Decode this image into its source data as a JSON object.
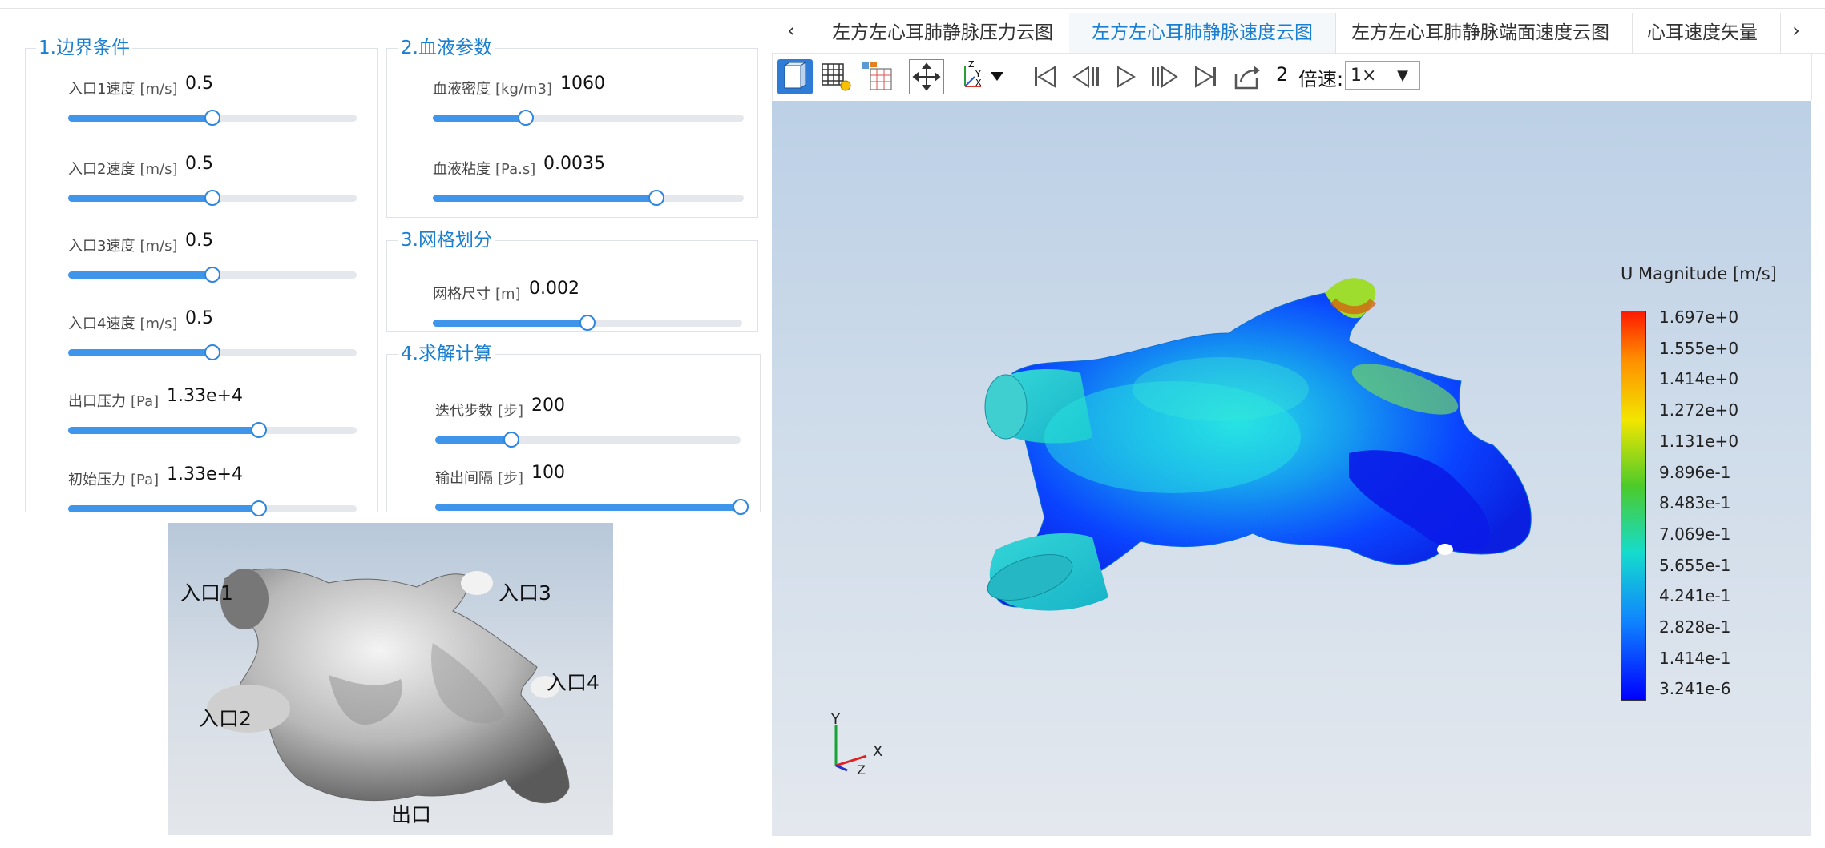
{
  "sections": {
    "boundary": {
      "title": "1.边界条件",
      "params": [
        {
          "label": "入口1速度",
          "unit": "[m/s]",
          "value": "0.5",
          "level": 0.5
        },
        {
          "label": "入口2速度",
          "unit": "[m/s]",
          "value": "0.5",
          "level": 0.5
        },
        {
          "label": "入口3速度",
          "unit": "[m/s]",
          "value": "0.5",
          "level": 0.5
        },
        {
          "label": "入口4速度",
          "unit": "[m/s]",
          "value": "0.5",
          "level": 0.5
        },
        {
          "label": "出口压力",
          "unit": "[Pa]",
          "value": "1.33e+4",
          "level": 0.66
        },
        {
          "label": "初始压力",
          "unit": "[Pa]",
          "value": "1.33e+4",
          "level": 0.66
        }
      ]
    },
    "blood": {
      "title": "2.血液参数",
      "params": [
        {
          "label": "血液密度",
          "unit": "[kg/m3]",
          "value": "1060",
          "level": 0.3
        },
        {
          "label": "血液粘度",
          "unit": "[Pa.s]",
          "value": "0.0035",
          "level": 0.72
        }
      ]
    },
    "mesh": {
      "title": "3.网格划分",
      "params": [
        {
          "label": "网格尺寸",
          "unit": "[m]",
          "value": "0.002",
          "level": 0.5
        }
      ]
    },
    "solver": {
      "title": "4.求解计算",
      "params": [
        {
          "label": "迭代步数",
          "unit": "[步]",
          "value": "200",
          "level": 0.25
        },
        {
          "label": "输出间隔",
          "unit": "[步]",
          "value": "100",
          "level": 1.0
        }
      ]
    }
  },
  "model_preview": {
    "labels": [
      "入口1",
      "入口2",
      "入口3",
      "入口4",
      "出口"
    ]
  },
  "tabs": {
    "prev_icon": "chevron-left-icon",
    "next_icon": "chevron-right-icon",
    "items": [
      "左方左心耳肺静脉压力云图",
      "左方左心耳肺静脉速度云图",
      "左方左心耳肺静脉端面速度云图",
      "心耳速度矢量"
    ],
    "active_index": 1
  },
  "toolbar": {
    "icons": [
      "view-cube-icon",
      "mesh-grid-icon",
      "table-grid-icon",
      "fit-view-icon",
      "axes-orientation-icon",
      "first-frame-icon",
      "step-back-icon",
      "play-icon",
      "step-forward-icon",
      "last-frame-icon",
      "export-icon"
    ],
    "frame_number": "2",
    "speed_label": "倍速:",
    "speed_value": "1×"
  },
  "viewport": {
    "legend": {
      "title": "U Magnitude [m/s]",
      "ticks": [
        "1.697e+0",
        "1.555e+0",
        "1.414e+0",
        "1.272e+0",
        "1.131e+0",
        "9.896e-1",
        "8.483e-1",
        "7.069e-1",
        "5.655e-1",
        "4.241e-1",
        "2.828e-1",
        "1.414e-1",
        "3.241e-6"
      ],
      "colors": {
        "max": "#ff1a00",
        "mid": "#4ccb2a",
        "min": "#0000ff"
      }
    },
    "axes": {
      "x": "X",
      "y": "Y",
      "z": "Z"
    }
  },
  "colors": {
    "accent": "#1a7fd0",
    "slider_fill": "#3f95ea",
    "slider_track": "#e4e7ec"
  }
}
